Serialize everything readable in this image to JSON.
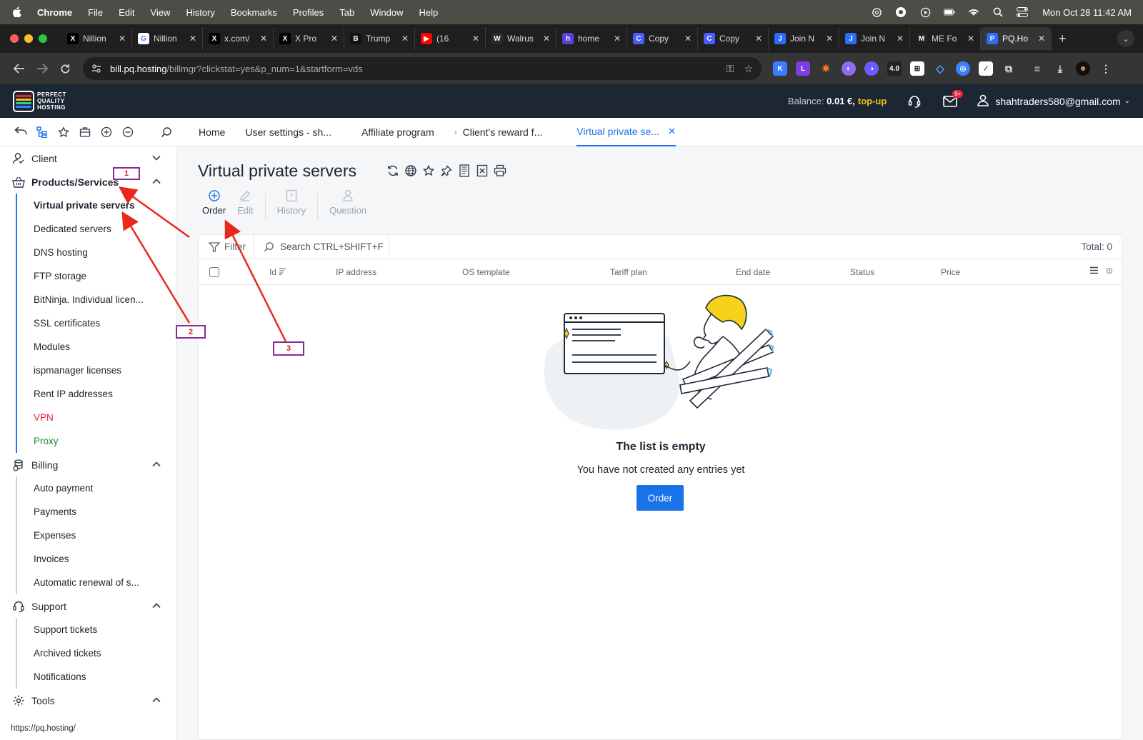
{
  "menubar": {
    "app": "Chrome",
    "items": [
      "File",
      "Edit",
      "View",
      "History",
      "Bookmarks",
      "Profiles",
      "Tab",
      "Window",
      "Help"
    ],
    "clock": "Mon Oct 28  11:42 AM"
  },
  "tabs": [
    {
      "label": "Nillion",
      "fav": "X",
      "color": "#000000"
    },
    {
      "label": "Nillion",
      "fav": "G",
      "color": "#ffffff"
    },
    {
      "label": "x.com/",
      "fav": "X",
      "color": "#000000"
    },
    {
      "label": "X Pro",
      "fav": "X",
      "color": "#000000"
    },
    {
      "label": "Trump",
      "fav": "B",
      "color": "#111111"
    },
    {
      "label": "(16",
      "fav": "▶",
      "color": "#ff0000"
    },
    {
      "label": "Walrus",
      "fav": "W",
      "color": "#2a2a2a"
    },
    {
      "label": "home",
      "fav": "h",
      "color": "#5a3fd8"
    },
    {
      "label": "Copy",
      "fav": "C",
      "color": "#4a5cff"
    },
    {
      "label": "Copy",
      "fav": "C",
      "color": "#4a5cff"
    },
    {
      "label": "Join N",
      "fav": "J",
      "color": "#2d6bff"
    },
    {
      "label": "Join N",
      "fav": "J",
      "color": "#2d6bff"
    },
    {
      "label": "ME Fo",
      "fav": "M",
      "color": "#222222"
    },
    {
      "label": "PQ.Ho",
      "fav": "P",
      "color": "#2d6bff"
    }
  ],
  "address": {
    "host": "bill.pq.hosting",
    "path": "/billmgr?clickstat=yes&p_num=1&startform=vds"
  },
  "header": {
    "logo_text": [
      "PERFECT",
      "QUALITY",
      "HOSTING"
    ],
    "balance_label": "Balance:",
    "balance_value": "0.01 €,",
    "topup": "top-up",
    "mail_badge": "9+",
    "user": "shahtraders580@gmail.com"
  },
  "breadcrumbs": [
    {
      "label": "Home"
    },
    {
      "label": "User settings - sh..."
    },
    {
      "label": "Affiliate program"
    },
    {
      "label": "Client's reward f..."
    },
    {
      "label": "Virtual private se..."
    }
  ],
  "sidebar": {
    "client": "Client",
    "products": "Products/Services",
    "product_items": [
      "Virtual private servers",
      "Dedicated servers",
      "DNS hosting",
      "FTP storage",
      "BitNinja. Individual licen...",
      "SSL certificates",
      "Modules",
      "ispmanager licenses",
      "Rent IP addresses",
      "VPN",
      "Proxy"
    ],
    "billing": "Billing",
    "billing_items": [
      "Auto payment",
      "Payments",
      "Expenses",
      "Invoices",
      "Automatic renewal of s..."
    ],
    "support": "Support",
    "support_items": [
      "Support tickets",
      "Archived tickets",
      "Notifications"
    ],
    "tools": "Tools"
  },
  "status_url": "https://pq.hosting/",
  "main": {
    "title": "Virtual private servers",
    "actions": {
      "order": "Order",
      "edit": "Edit",
      "history": "History",
      "question": "Question"
    },
    "filter": "Filter",
    "search_placeholder": "Search CTRL+SHIFT+F",
    "total": "Total: 0",
    "columns": [
      "Id",
      "IP address",
      "OS template",
      "Tariff plan",
      "End date",
      "Status",
      "Price"
    ],
    "empty_title": "The list is empty",
    "empty_sub": "You have not created any entries yet",
    "order_button": "Order"
  },
  "annotations": [
    "1",
    "2",
    "3"
  ],
  "colors": {
    "accent": "#1a73e8",
    "header_bg": "#1d2734",
    "topup": "#f2c20f",
    "annotation_arrow": "#e8281e",
    "annotation_box": "#8a2b9a"
  }
}
